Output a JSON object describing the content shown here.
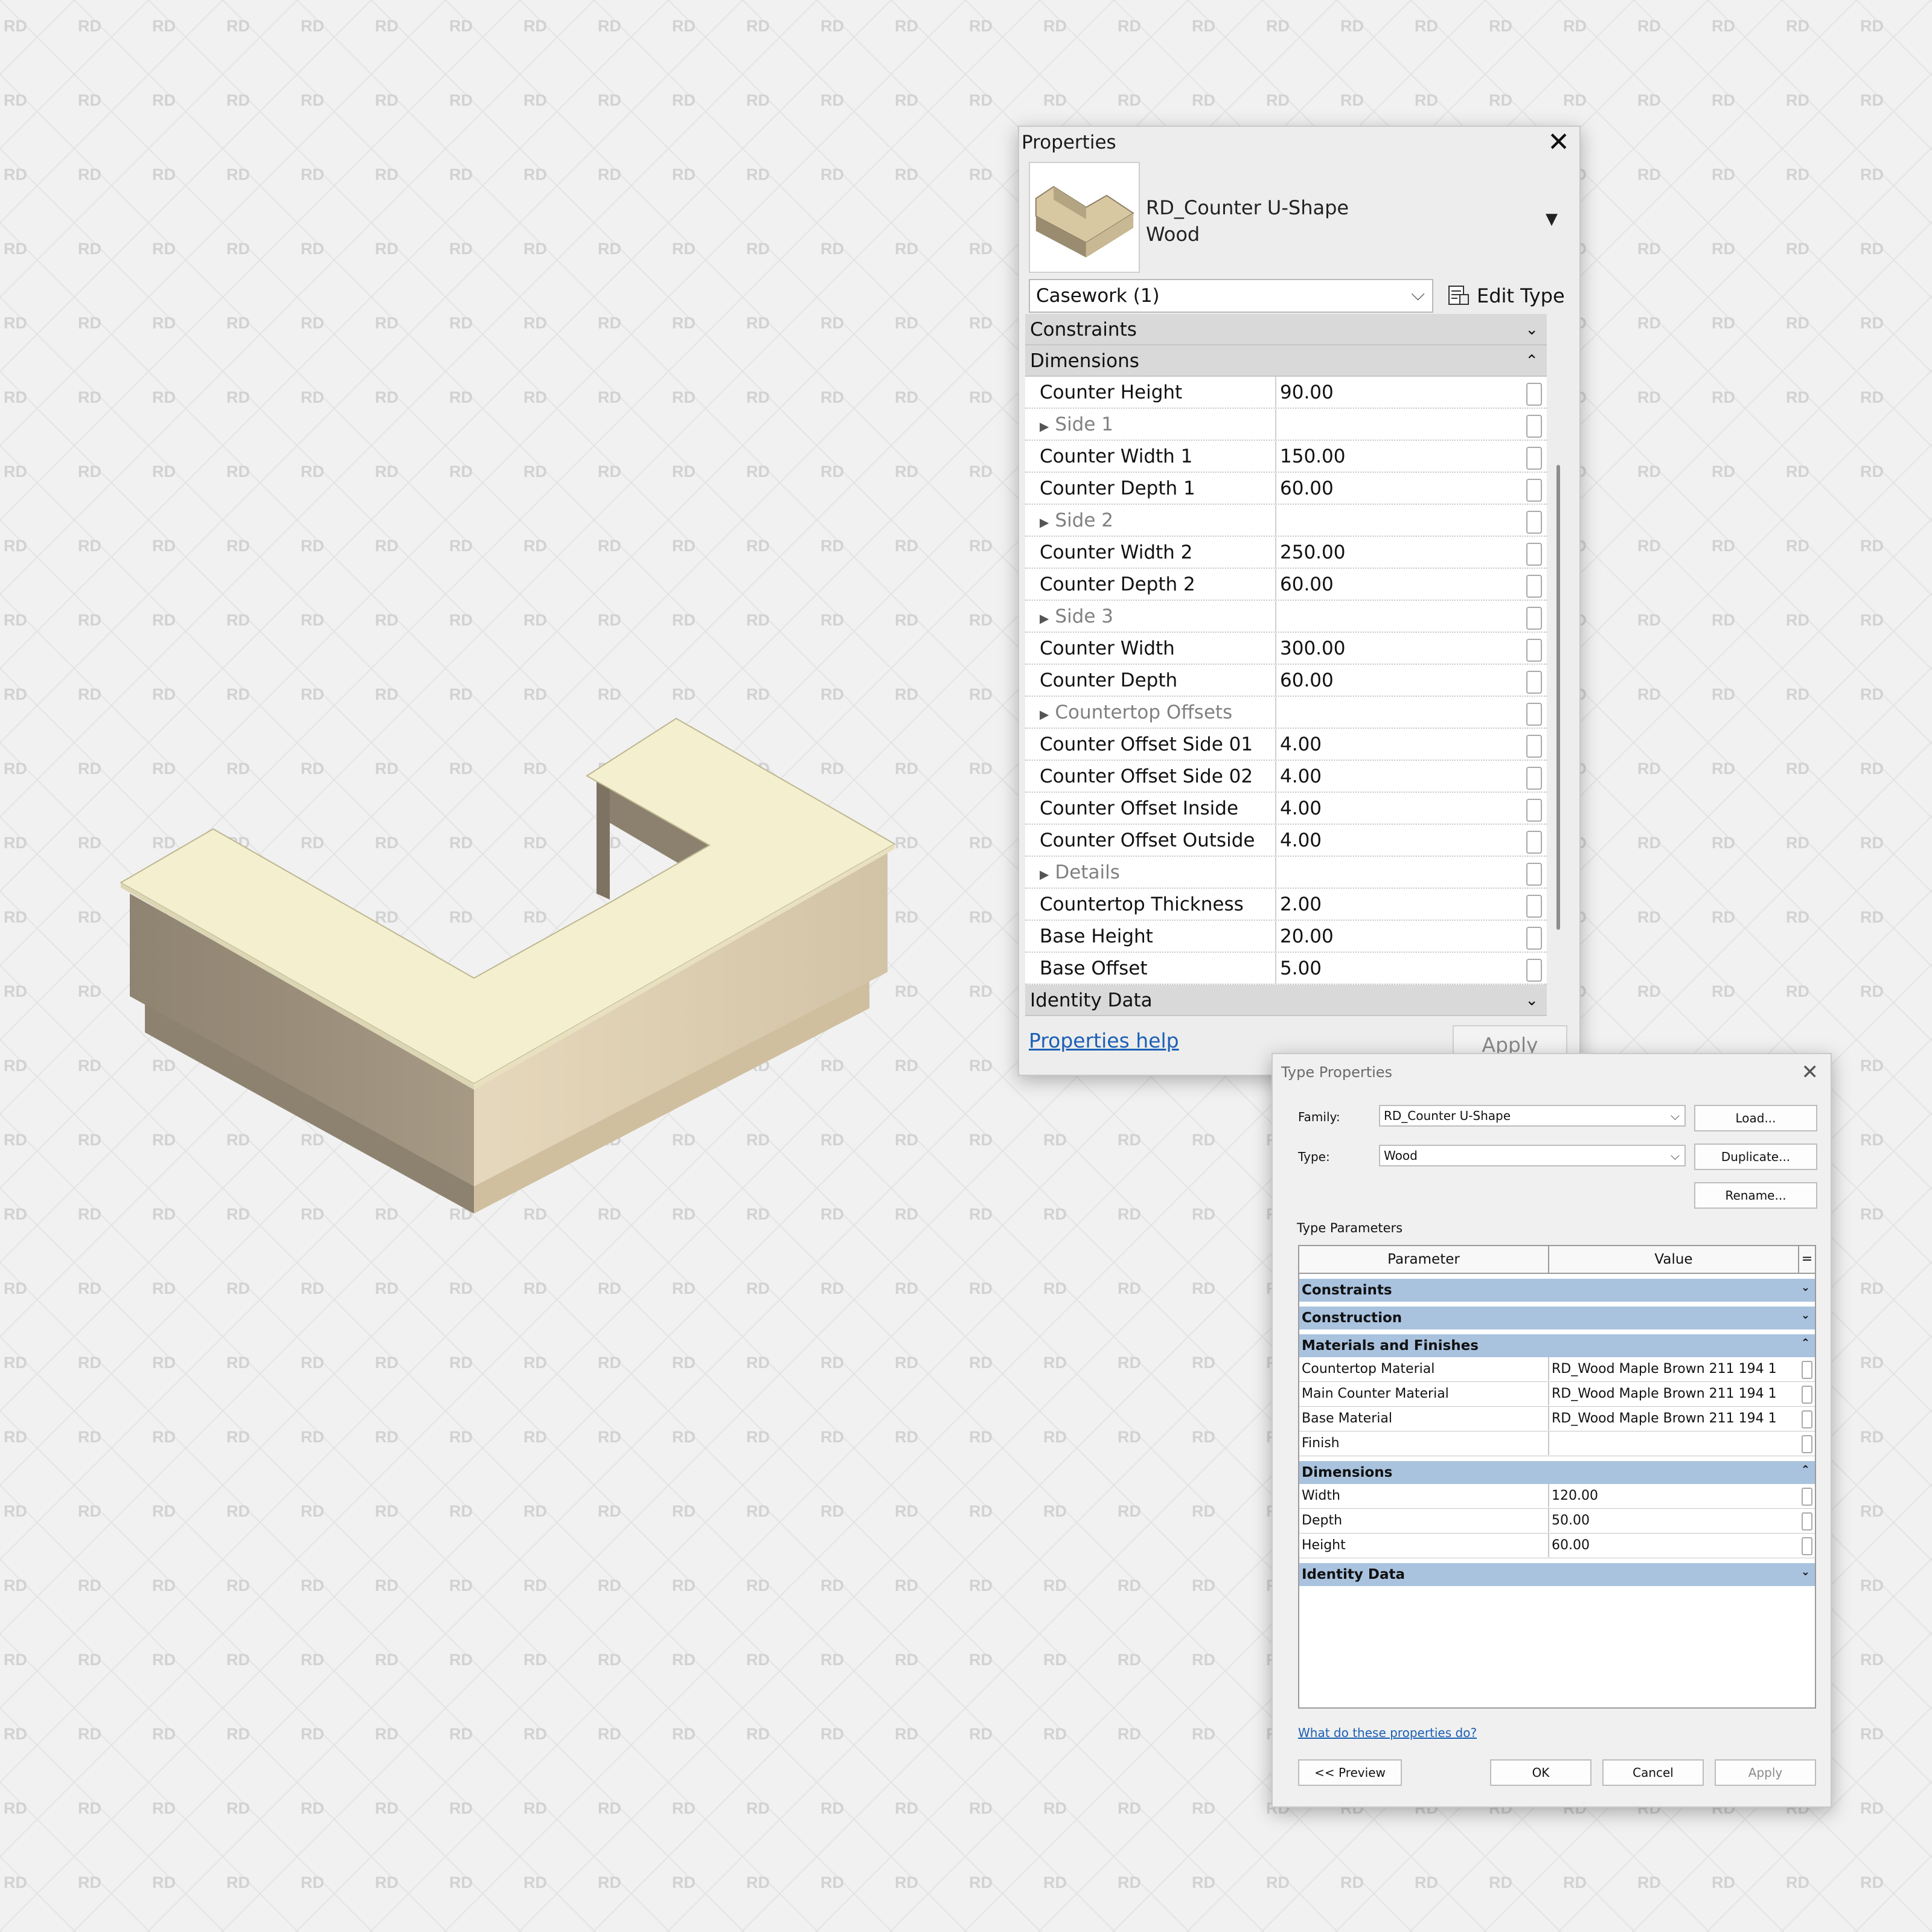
{
  "watermark": {
    "text": "RD"
  },
  "properties_palette": {
    "title": "Properties",
    "type_name_line1": "RD_Counter U-Shape",
    "type_name_line2": "Wood",
    "category": "Casework (1)",
    "edit_type_label": "Edit Type",
    "groups": {
      "constraints": "Constraints",
      "dimensions": "Dimensions",
      "identity": "Identity Data"
    },
    "rows": [
      {
        "label": "Counter Height",
        "value": "90.00"
      },
      {
        "label": "Side 1",
        "value": "",
        "sub": true
      },
      {
        "label": "Counter Width 1",
        "value": "150.00"
      },
      {
        "label": "Counter Depth 1",
        "value": "60.00"
      },
      {
        "label": "Side 2",
        "value": "",
        "sub": true
      },
      {
        "label": "Counter Width 2",
        "value": "250.00"
      },
      {
        "label": "Counter Depth 2",
        "value": "60.00"
      },
      {
        "label": "Side 3",
        "value": "",
        "sub": true
      },
      {
        "label": "Counter Width",
        "value": "300.00"
      },
      {
        "label": "Counter Depth",
        "value": "60.00"
      },
      {
        "label": "Countertop Offsets",
        "value": "",
        "sub": true
      },
      {
        "label": "Counter Offset Side 01",
        "value": "4.00"
      },
      {
        "label": "Counter Offset Side 02",
        "value": "4.00"
      },
      {
        "label": "Counter Offset Inside",
        "value": "4.00"
      },
      {
        "label": "Counter Offset Outside",
        "value": "4.00"
      },
      {
        "label": "Details",
        "value": "",
        "sub": true
      },
      {
        "label": "Countertop Thickness",
        "value": "2.00"
      },
      {
        "label": "Base Height",
        "value": "20.00"
      },
      {
        "label": "Base Offset",
        "value": "5.00"
      }
    ],
    "help_link": "Properties help",
    "apply_label": "Apply",
    "icons": {
      "close": "close-icon",
      "type_dropdown": "chevron-down-icon",
      "edit_type": "edit-type-icon"
    }
  },
  "type_properties": {
    "title": "Type Properties",
    "family_label": "Family:",
    "family_value": "RD_Counter U-Shape",
    "type_label": "Type:",
    "type_value": "Wood",
    "load_label": "Load...",
    "duplicate_label": "Duplicate...",
    "rename_label": "Rename...",
    "type_parameters_label": "Type Parameters",
    "col_parameter": "Parameter",
    "col_value": "Value",
    "col_extra": "=",
    "groups": {
      "constraints": "Constraints",
      "construction": "Construction",
      "materials": "Materials and Finishes",
      "dimensions": "Dimensions",
      "identity": "Identity Data"
    },
    "material_rows": [
      {
        "param": "Countertop Material",
        "value": "RD_Wood Maple Brown 211 194 1"
      },
      {
        "param": "Main Counter Material",
        "value": "RD_Wood Maple Brown 211 194 1"
      },
      {
        "param": "Base Material",
        "value": "RD_Wood Maple Brown 211 194 1"
      },
      {
        "param": "Finish",
        "value": ""
      }
    ],
    "dimension_rows": [
      {
        "param": "Width",
        "value": "120.00"
      },
      {
        "param": "Depth",
        "value": "50.00"
      },
      {
        "param": "Height",
        "value": "60.00"
      }
    ],
    "help_link": "What do these properties do?",
    "preview_label": "<< Preview",
    "ok_label": "OK",
    "cancel_label": "Cancel",
    "apply_label": "Apply"
  }
}
